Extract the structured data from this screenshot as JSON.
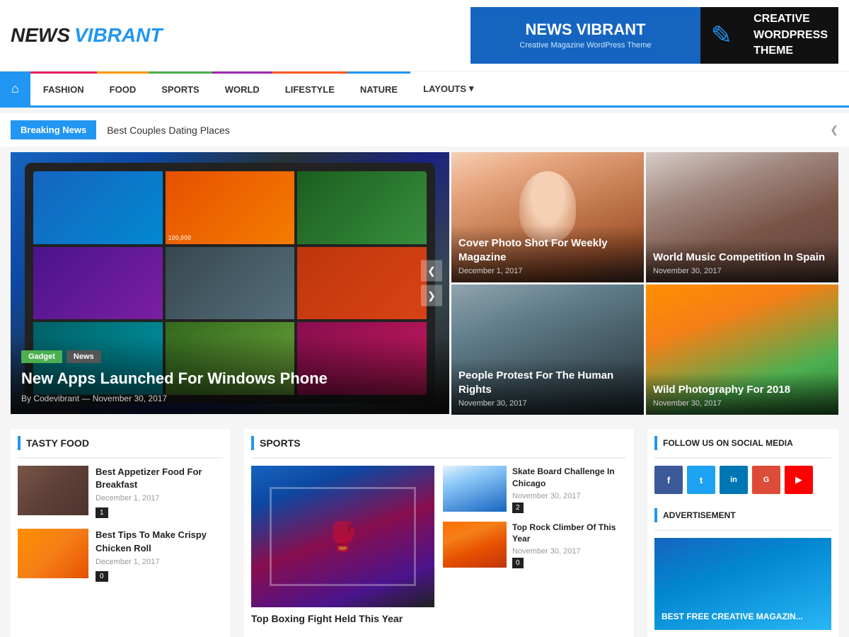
{
  "header": {
    "logo_news": "NEWS",
    "logo_vibrant": "VIBRANT",
    "ad_title": "NEWS VIBRANT",
    "ad_subtitle": "Creative Magazine WordPress Theme",
    "ad_right1": "CREATIVE",
    "ad_right2": "WORDPRESS",
    "ad_right3": "THEME"
  },
  "nav": {
    "home_icon": "⌂",
    "items": [
      {
        "label": "FASHION",
        "class": "nav-fashion"
      },
      {
        "label": "FOOD",
        "class": "nav-food"
      },
      {
        "label": "SPORTS",
        "class": "nav-sports"
      },
      {
        "label": "WORLD",
        "class": "nav-world"
      },
      {
        "label": "LIFESTYLE",
        "class": "nav-lifestyle"
      },
      {
        "label": "NATURE",
        "class": "nav-nature"
      },
      {
        "label": "LAYOUTS ▾",
        "class": "nav-layouts"
      }
    ]
  },
  "breaking_news": {
    "badge": "Breaking News",
    "text": "Best Couples Dating Places",
    "arrow": "❮"
  },
  "hero": {
    "tags": [
      "Gadget",
      "News"
    ],
    "title": "New Apps Launched For Windows Phone",
    "meta": "By Codevibrant — November 30, 2017",
    "prev": "❮",
    "next": "❯"
  },
  "hero_sub": [
    {
      "title": "Cover Photo Shot For Weekly Magazine",
      "date": "December 1, 2017"
    },
    {
      "title": "People Protest For The Human Rights",
      "date": "November 30, 2017"
    },
    {
      "title": "World Music Competition In Spain",
      "date": "November 30, 2017"
    },
    {
      "title": "Wild Photography For 2018",
      "date": "November 30, 2017"
    }
  ],
  "tasty_food": {
    "section_title": "TASTY FOOD",
    "items": [
      {
        "title": "Best Appetizer Food For Breakfast",
        "date": "December 1, 2017",
        "count": "1"
      },
      {
        "title": "Best Tips To Make Crispy Chicken Roll",
        "date": "December 1, 2017",
        "count": "0"
      }
    ]
  },
  "sports": {
    "section_title": "SPORTS",
    "main_title": "Top Boxing Fight Held This Year",
    "side_items": [
      {
        "title": "Skate Board Challenge In Chicago",
        "date": "November 30, 2017",
        "count": "2"
      },
      {
        "title": "Top Rock Climber Of This Year",
        "date": "November 30, 2017",
        "count": "0"
      }
    ]
  },
  "social": {
    "section_title": "FOLLOW US ON SOCIAL MEDIA",
    "icons": [
      "f",
      "t",
      "in",
      "G+",
      "▶"
    ],
    "ad_title": "ADVERTISEMENT",
    "ad_text": "BEST FREE CREATIVE MAGAZIN..."
  }
}
